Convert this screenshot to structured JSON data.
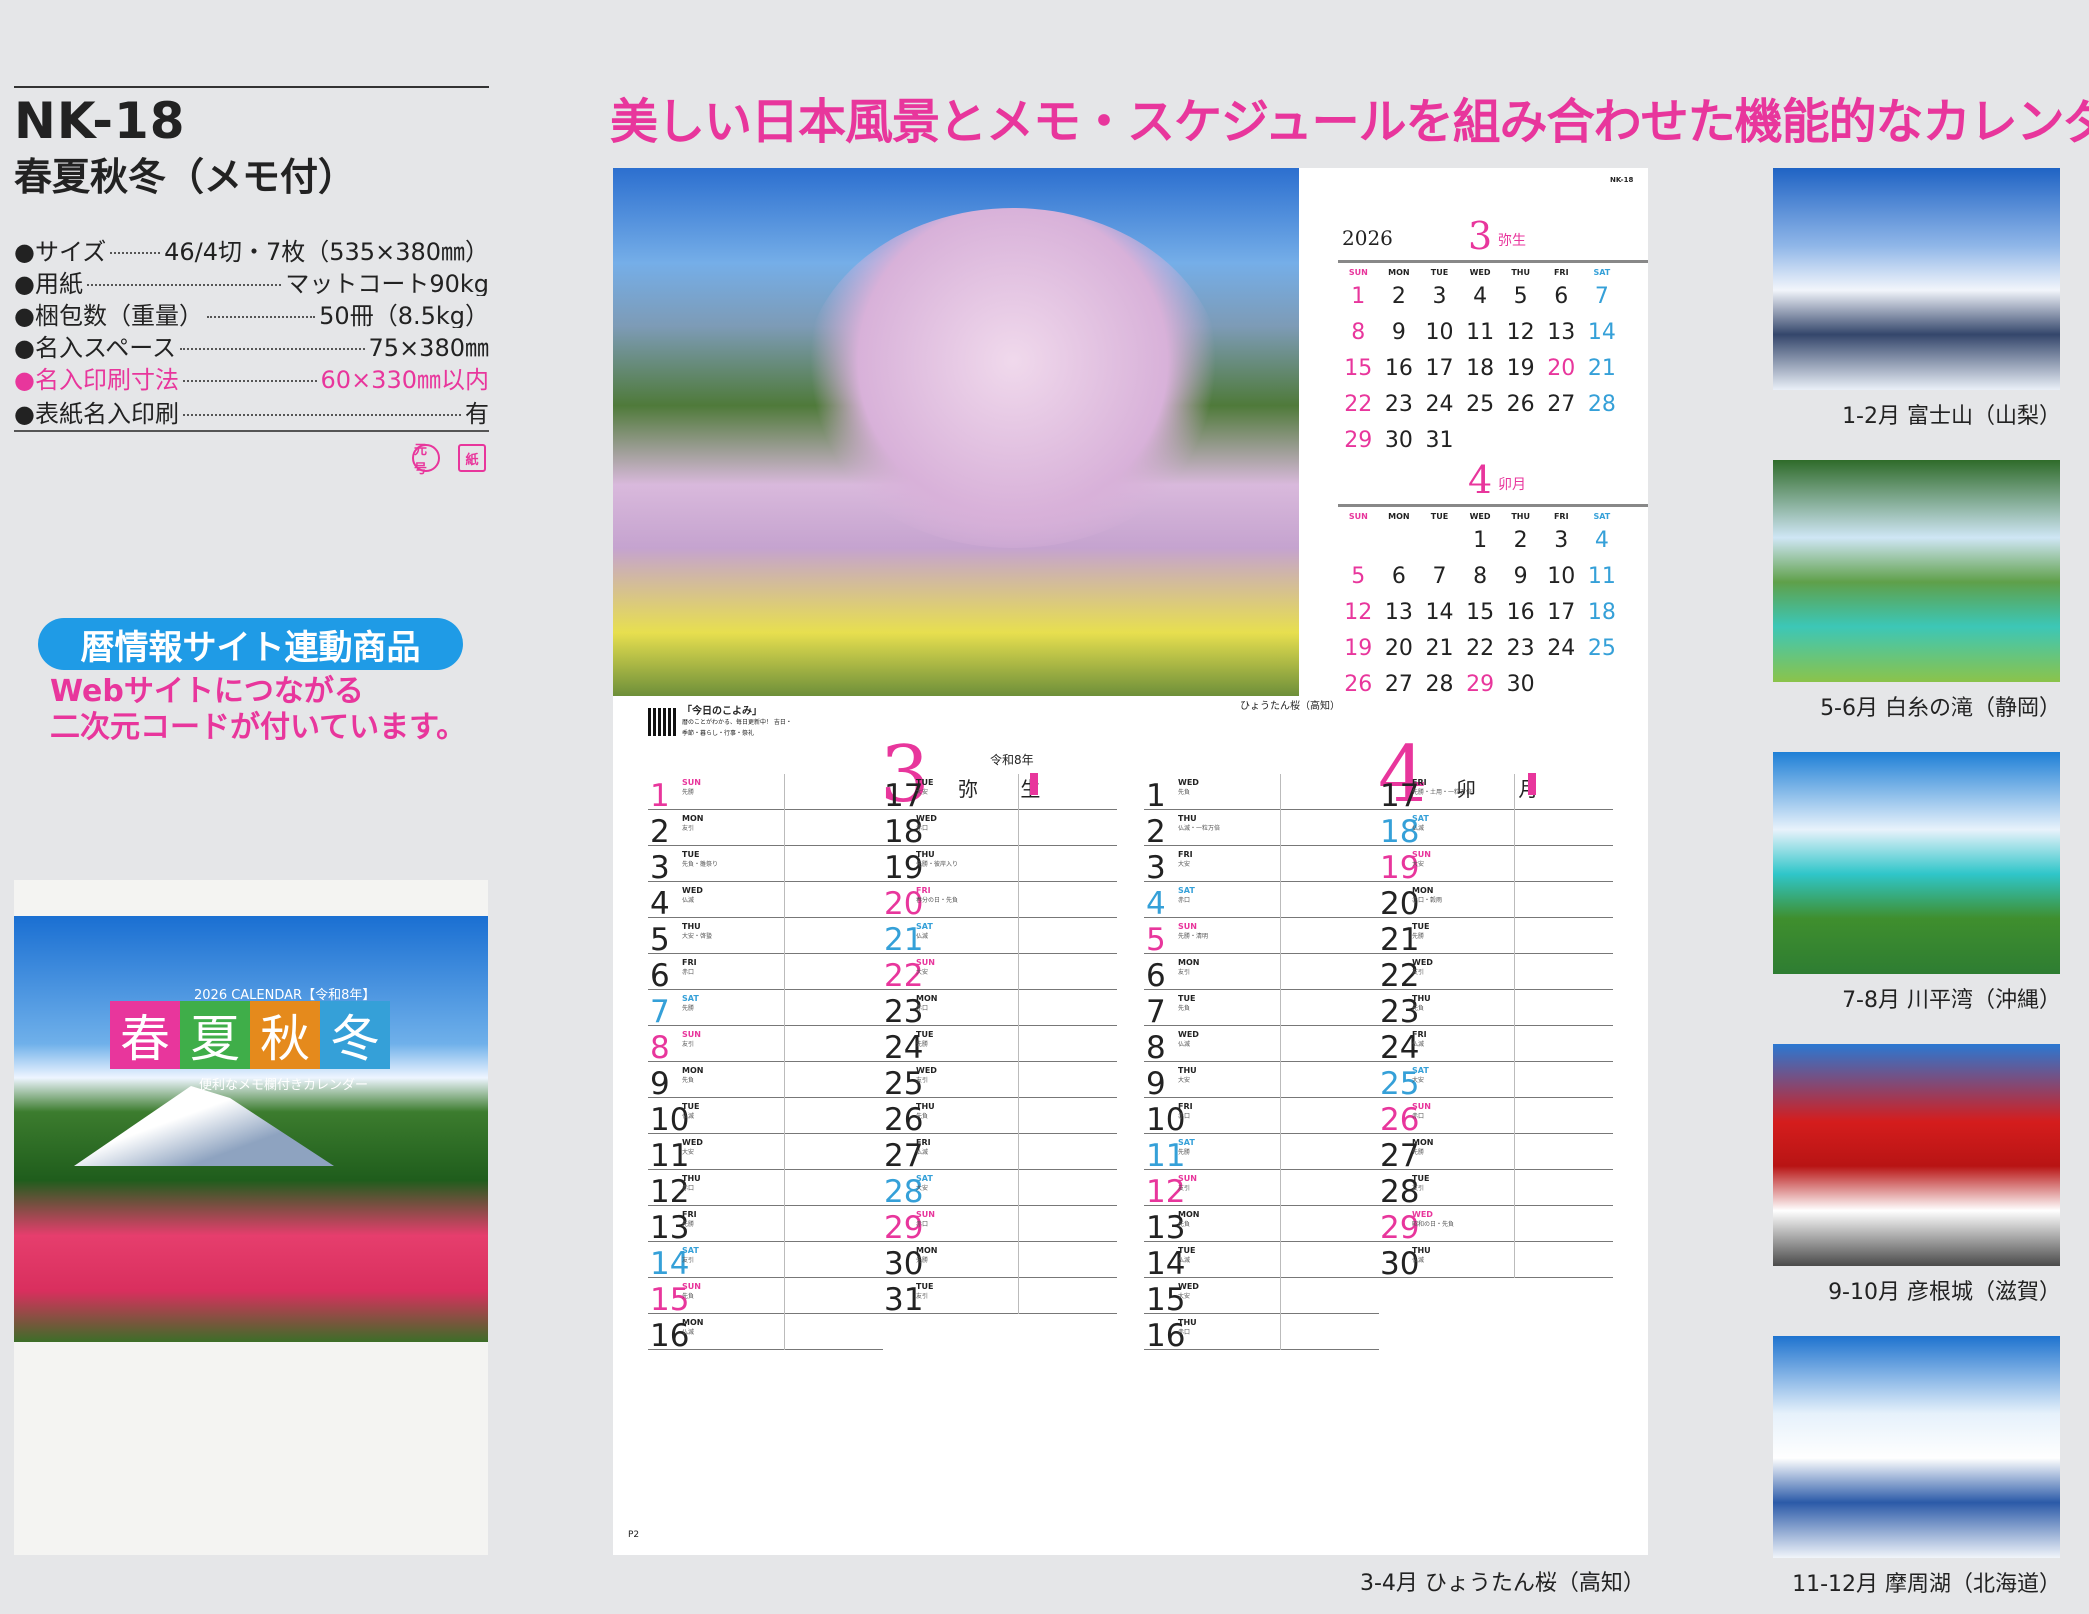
{
  "product": {
    "code": "NK-18",
    "name": "春夏秋冬（メモ付）",
    "specs": [
      {
        "label": "●サイズ",
        "value": "46/4切・7枚（535×380㎜）"
      },
      {
        "label": "●用紙",
        "value": "マットコート90kg"
      },
      {
        "label": "●梱包数（重量）",
        "value": "50冊（8.5kg）"
      },
      {
        "label": "●名入スペース",
        "value": "75×380㎜"
      },
      {
        "label": "●名入印刷寸法",
        "value": "60×330㎜以内"
      },
      {
        "label": "●表紙名入印刷",
        "value": "有"
      }
    ],
    "badges": [
      "元号",
      "紙"
    ],
    "pill": "暦情報サイト連動商品",
    "pill_text_1": "Webサイトにつながる",
    "pill_text_2": "二次元コードが付いています。"
  },
  "cover": {
    "year_line": "2026 CALENDAR【令和8年】",
    "title_chars": [
      "春",
      "夏",
      "秋",
      "冬"
    ],
    "title_colors": [
      "#e8369c",
      "#3fae49",
      "#e58a1c",
      "#35a0d8"
    ],
    "subtitle": "便利なメモ欄付きカレンダー"
  },
  "slogan": "美しい日本風景とメモ・スケジュールを組み合わせた機能的なカレンダー",
  "sheet": {
    "code": "NK-18",
    "photo_caption": "ひょうたん桜（高知）",
    "koyomi_title": "「今日のこよみ」",
    "koyomi_text": "暦のことがわかる、毎日更新中！ 吉日・季節・暮らし・行事・祭礼",
    "page": "P2",
    "caption": "3-4月 ひょうたん桜（高知）"
  },
  "mini": [
    {
      "year": "2026",
      "month": "3",
      "jp": "弥生",
      "weekdays": [
        "SUN",
        "MON",
        "TUE",
        "WED",
        "THU",
        "FRI",
        "SAT"
      ],
      "offset": 0,
      "days": [
        "1",
        "2",
        "3",
        "4",
        "5",
        "6",
        "7",
        "8",
        "9",
        "10",
        "11",
        "12",
        "13",
        "14",
        "15",
        "16",
        "17",
        "18",
        "19",
        "20",
        "21",
        "22",
        "23",
        "24",
        "25",
        "26",
        "27",
        "28",
        "29",
        "30",
        "31"
      ],
      "holidays": [
        "20"
      ]
    },
    {
      "year": "",
      "month": "4",
      "jp": "卯月",
      "weekdays": [
        "SUN",
        "MON",
        "TUE",
        "WED",
        "THU",
        "FRI",
        "SAT"
      ],
      "offset": 3,
      "days": [
        "1",
        "2",
        "3",
        "4",
        "5",
        "6",
        "7",
        "8",
        "9",
        "10",
        "11",
        "12",
        "13",
        "14",
        "15",
        "16",
        "17",
        "18",
        "19",
        "20",
        "21",
        "22",
        "23",
        "24",
        "25",
        "26",
        "27",
        "28",
        "29",
        "30"
      ],
      "holidays": [
        "29"
      ]
    }
  ],
  "big": [
    {
      "month": "3",
      "era": "令和8年",
      "name": "弥 生",
      "rows": [
        {
          "d": "1",
          "w": "SUN",
          "r": "先勝"
        },
        {
          "d": "2",
          "w": "MON",
          "r": "友引"
        },
        {
          "d": "3",
          "w": "TUE",
          "r": "先負・雛祭り"
        },
        {
          "d": "4",
          "w": "WED",
          "r": "仏滅"
        },
        {
          "d": "5",
          "w": "THU",
          "r": "大安・啓蟄"
        },
        {
          "d": "6",
          "w": "FRI",
          "r": "赤口"
        },
        {
          "d": "7",
          "w": "SAT",
          "r": "先勝"
        },
        {
          "d": "8",
          "w": "SUN",
          "r": "友引"
        },
        {
          "d": "9",
          "w": "MON",
          "r": "先負"
        },
        {
          "d": "10",
          "w": "TUE",
          "r": "仏滅"
        },
        {
          "d": "11",
          "w": "WED",
          "r": "大安"
        },
        {
          "d": "12",
          "w": "THU",
          "r": "赤口"
        },
        {
          "d": "13",
          "w": "FRI",
          "r": "先勝"
        },
        {
          "d": "14",
          "w": "SAT",
          "r": "友引"
        },
        {
          "d": "15",
          "w": "SUN",
          "r": "先負"
        },
        {
          "d": "16",
          "w": "MON",
          "r": "仏滅"
        },
        {
          "d": "17",
          "w": "TUE",
          "r": "大安"
        },
        {
          "d": "18",
          "w": "WED",
          "r": "赤口"
        },
        {
          "d": "19",
          "w": "THU",
          "r": "先勝・彼岸入り"
        },
        {
          "d": "20",
          "w": "FRI",
          "r": "春分の日・先負"
        },
        {
          "d": "21",
          "w": "SAT",
          "r": "仏滅"
        },
        {
          "d": "22",
          "w": "SUN",
          "r": "大安"
        },
        {
          "d": "23",
          "w": "MON",
          "r": "赤口"
        },
        {
          "d": "24",
          "w": "TUE",
          "r": "先勝"
        },
        {
          "d": "25",
          "w": "WED",
          "r": "友引"
        },
        {
          "d": "26",
          "w": "THU",
          "r": "先負"
        },
        {
          "d": "27",
          "w": "FRI",
          "r": "仏滅"
        },
        {
          "d": "28",
          "w": "SAT",
          "r": "大安"
        },
        {
          "d": "29",
          "w": "SUN",
          "r": "赤口"
        },
        {
          "d": "30",
          "w": "MON",
          "r": "先勝"
        },
        {
          "d": "31",
          "w": "TUE",
          "r": "友引"
        }
      ]
    },
    {
      "month": "4",
      "era": "",
      "name": "卯 月",
      "rows": [
        {
          "d": "1",
          "w": "WED",
          "r": "先負"
        },
        {
          "d": "2",
          "w": "THU",
          "r": "仏滅・一粒万倍"
        },
        {
          "d": "3",
          "w": "FRI",
          "r": "大安"
        },
        {
          "d": "4",
          "w": "SAT",
          "r": "赤口"
        },
        {
          "d": "5",
          "w": "SUN",
          "r": "先勝・清明"
        },
        {
          "d": "6",
          "w": "MON",
          "r": "友引"
        },
        {
          "d": "7",
          "w": "TUE",
          "r": "先負"
        },
        {
          "d": "8",
          "w": "WED",
          "r": "仏滅"
        },
        {
          "d": "9",
          "w": "THU",
          "r": "大安"
        },
        {
          "d": "10",
          "w": "FRI",
          "r": "赤口"
        },
        {
          "d": "11",
          "w": "SAT",
          "r": "先勝"
        },
        {
          "d": "12",
          "w": "SUN",
          "r": "友引"
        },
        {
          "d": "13",
          "w": "MON",
          "r": "先負"
        },
        {
          "d": "14",
          "w": "TUE",
          "r": "仏滅"
        },
        {
          "d": "15",
          "w": "WED",
          "r": "大安"
        },
        {
          "d": "16",
          "w": "THU",
          "r": "赤口"
        },
        {
          "d": "17",
          "w": "FRI",
          "r": "先勝・土用・一粒万倍"
        },
        {
          "d": "18",
          "w": "SAT",
          "r": "仏滅"
        },
        {
          "d": "19",
          "w": "SUN",
          "r": "大安"
        },
        {
          "d": "20",
          "w": "MON",
          "r": "赤口・穀雨"
        },
        {
          "d": "21",
          "w": "TUE",
          "r": "先勝"
        },
        {
          "d": "22",
          "w": "WED",
          "r": "友引"
        },
        {
          "d": "23",
          "w": "THU",
          "r": "先負"
        },
        {
          "d": "24",
          "w": "FRI",
          "r": "仏滅"
        },
        {
          "d": "25",
          "w": "SAT",
          "r": "大安"
        },
        {
          "d": "26",
          "w": "SUN",
          "r": "赤口"
        },
        {
          "d": "27",
          "w": "MON",
          "r": "先勝"
        },
        {
          "d": "28",
          "w": "TUE",
          "r": "友引"
        },
        {
          "d": "29",
          "w": "WED",
          "r": "昭和の日・先負"
        },
        {
          "d": "30",
          "w": "THU",
          "r": "仏滅"
        }
      ]
    }
  ],
  "thumbnails": [
    {
      "caption": "1-2月 富士山（山梨）",
      "colors": [
        "#1f63c4",
        "#8fb6e8",
        "#f2f5fb",
        "#34466b",
        "#eaf0f8"
      ]
    },
    {
      "caption": "5-6月 白糸の滝（静岡）",
      "colors": [
        "#2f6b2a",
        "#cfe6f5",
        "#5fa04a",
        "#3cc7b7",
        "#8bc34a"
      ]
    },
    {
      "caption": "7-8月 川平湾（沖縄）",
      "colors": [
        "#1e7fd6",
        "#e8f2fb",
        "#2fc6c9",
        "#3f8f2e",
        "#2e7d32"
      ]
    },
    {
      "caption": "9-10月 彦根城（滋賀）",
      "colors": [
        "#2b78d2",
        "#d51d1d",
        "#b81414",
        "#ffffff",
        "#4a4a4a"
      ]
    },
    {
      "caption": "11-12月 摩周湖（北海道）",
      "colors": [
        "#1e73cf",
        "#e6f1fb",
        "#ffffff",
        "#2b5aa8",
        "#f1f5fa"
      ]
    }
  ]
}
